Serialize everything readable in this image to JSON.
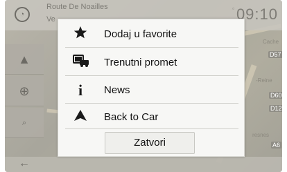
{
  "header": {
    "street": "Route De Noailles",
    "sub": "Ve",
    "clock": "09:10"
  },
  "map": {
    "labels": [
      "D57",
      "D60",
      "D12",
      "A6"
    ],
    "names": [
      "Cache",
      "-Reine",
      "resnes"
    ]
  },
  "popup": {
    "items": [
      {
        "icon": "star-icon",
        "label": "Dodaj u favorite"
      },
      {
        "icon": "traffic-icon",
        "label": "Trenutni promet"
      },
      {
        "icon": "info-icon",
        "label": "News"
      },
      {
        "icon": "navigation-arrow-icon",
        "label": "Back to Car"
      }
    ],
    "close_label": "Zatvori"
  }
}
